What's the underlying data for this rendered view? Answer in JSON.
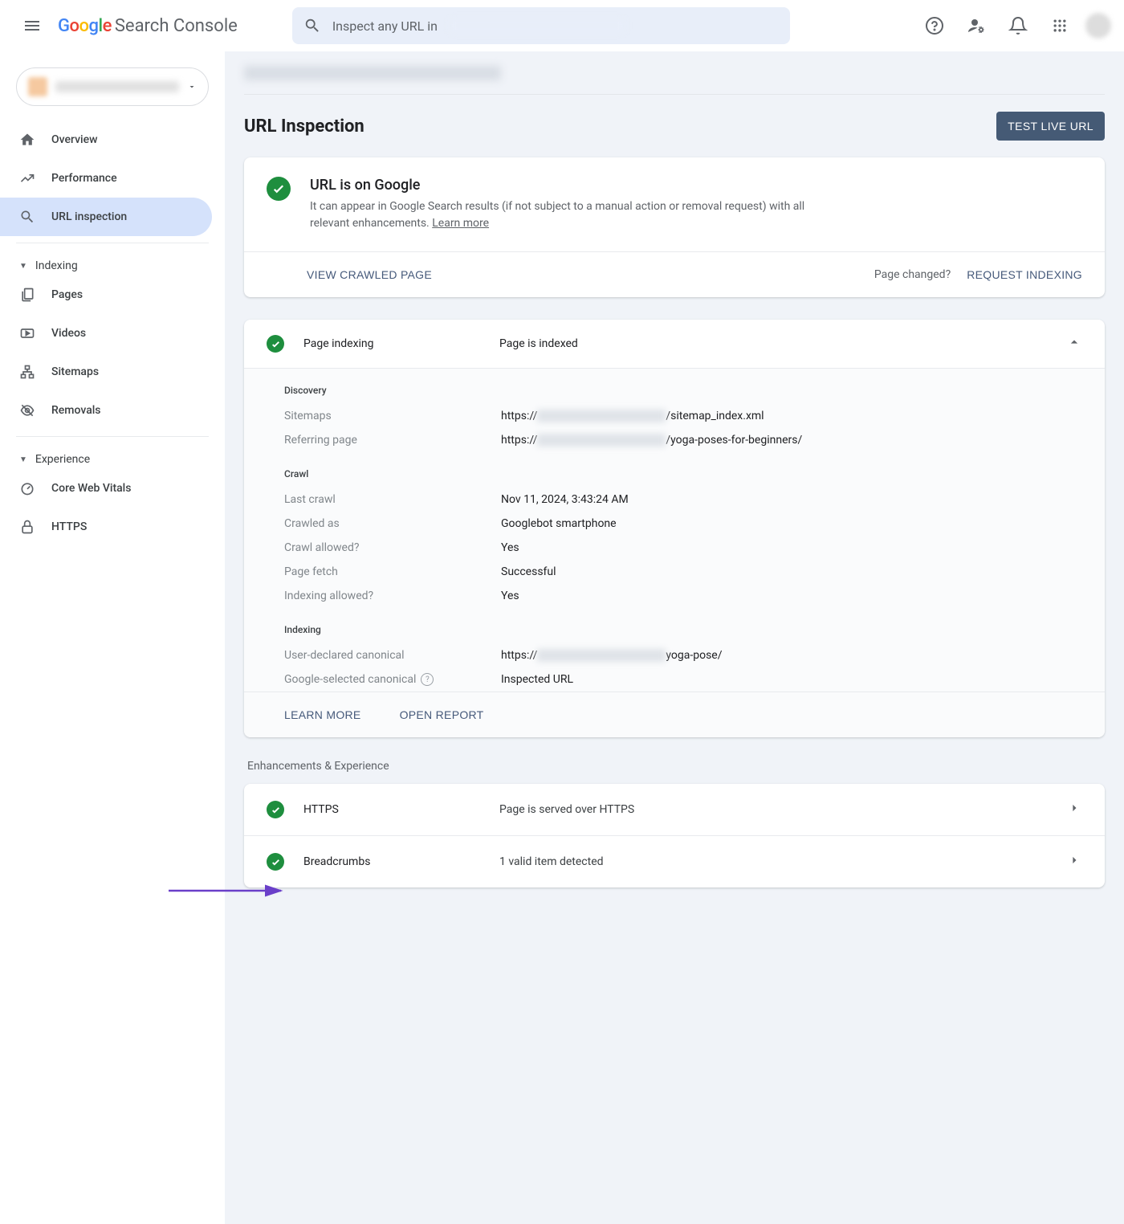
{
  "header": {
    "logo_product": "Search Console",
    "search_placeholder": "Inspect any URL in "
  },
  "sidebar": {
    "items_top": [
      {
        "id": "overview",
        "label": "Overview"
      },
      {
        "id": "performance",
        "label": "Performance"
      },
      {
        "id": "url-inspection",
        "label": "URL inspection"
      }
    ],
    "section_indexing": "Indexing",
    "items_indexing": [
      {
        "id": "pages",
        "label": "Pages"
      },
      {
        "id": "videos",
        "label": "Videos"
      },
      {
        "id": "sitemaps",
        "label": "Sitemaps"
      },
      {
        "id": "removals",
        "label": "Removals"
      }
    ],
    "section_experience": "Experience",
    "items_experience": [
      {
        "id": "cwv",
        "label": "Core Web Vitals"
      },
      {
        "id": "https",
        "label": "HTTPS"
      }
    ]
  },
  "page": {
    "title": "URL Inspection",
    "test_button": "TEST LIVE URL",
    "status_title": "URL is on Google",
    "status_sub": "It can appear in Google Search results (if not subject to a manual action or removal request) with all relevant enhancements. ",
    "learn_more": "Learn more",
    "view_crawled": "VIEW CRAWLED PAGE",
    "page_changed": "Page changed?",
    "request_indexing": "REQUEST INDEXING"
  },
  "indexing": {
    "header_label": "Page indexing",
    "header_value": "Page is indexed",
    "sections": {
      "discovery": {
        "title": "Discovery",
        "sitemaps_k": "Sitemaps",
        "sitemaps_v_pre": "https://",
        "sitemaps_v_post": "/sitemap_index.xml",
        "ref_k": "Referring page",
        "ref_v_pre": "https://",
        "ref_v_post": "/yoga-poses-for-beginners/"
      },
      "crawl": {
        "title": "Crawl",
        "rows": [
          {
            "k": "Last crawl",
            "v": "Nov 11, 2024, 3:43:24 AM"
          },
          {
            "k": "Crawled as",
            "v": "Googlebot smartphone"
          },
          {
            "k": "Crawl allowed?",
            "v": "Yes"
          },
          {
            "k": "Page fetch",
            "v": "Successful"
          },
          {
            "k": "Indexing allowed?",
            "v": "Yes"
          }
        ]
      },
      "index": {
        "title": "Indexing",
        "user_canon_k": "User-declared canonical",
        "user_canon_v_pre": "https://",
        "user_canon_v_post": "yoga-pose/",
        "google_canon_k": "Google-selected canonical",
        "google_canon_v": "Inspected URL"
      }
    },
    "footer_learn": "LEARN MORE",
    "footer_open": "OPEN REPORT"
  },
  "enhancements": {
    "title": "Enhancements & Experience",
    "rows": [
      {
        "label": "HTTPS",
        "value": "Page is served over HTTPS"
      },
      {
        "label": "Breadcrumbs",
        "value": "1 valid item detected"
      }
    ]
  }
}
